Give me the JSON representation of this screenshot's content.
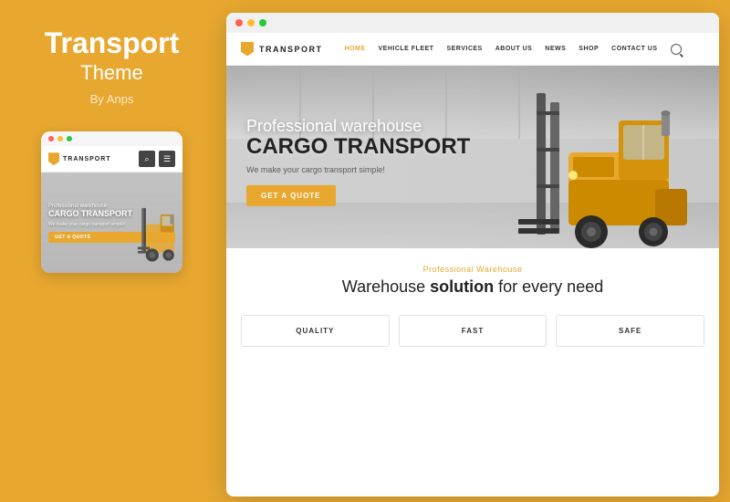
{
  "left": {
    "title": "Transport",
    "subtitle": "Theme",
    "byline": "By Anps",
    "mobile_logo": "TRANSPORT",
    "mobile_hero_sub": "Professional warehouse",
    "mobile_hero_title": "CARGO TRANSPORT",
    "mobile_hero_tagline": "We make your cargo transport simple!",
    "mobile_cta": "GET A QUOTE"
  },
  "browser": {
    "nav": {
      "logo": "TRANSPORT",
      "links": [
        {
          "label": "HOME",
          "active": true
        },
        {
          "label": "VEHICLE FLEET",
          "active": false
        },
        {
          "label": "SERVICES",
          "active": false
        },
        {
          "label": "ABOUT US",
          "active": false
        },
        {
          "label": "NEWS",
          "active": false
        },
        {
          "label": "SHOP",
          "active": false
        },
        {
          "label": "CONTACT US",
          "active": false
        }
      ]
    },
    "hero": {
      "subtitle": "Professional warehouse",
      "title_light": "Professional warehouse",
      "title_bold": "CARGO TRANSPORT",
      "tagline": "We make your cargo transport simple!",
      "cta": "GET A QUOTE"
    },
    "warehouse": {
      "label": "Professional Warehouse",
      "title_plain": "Warehouse ",
      "title_bold": "solution",
      "title_end": " for every need"
    },
    "cards": [
      {
        "title": "QUALITY"
      },
      {
        "title": "FAST"
      },
      {
        "title": "SAFE"
      }
    ]
  }
}
